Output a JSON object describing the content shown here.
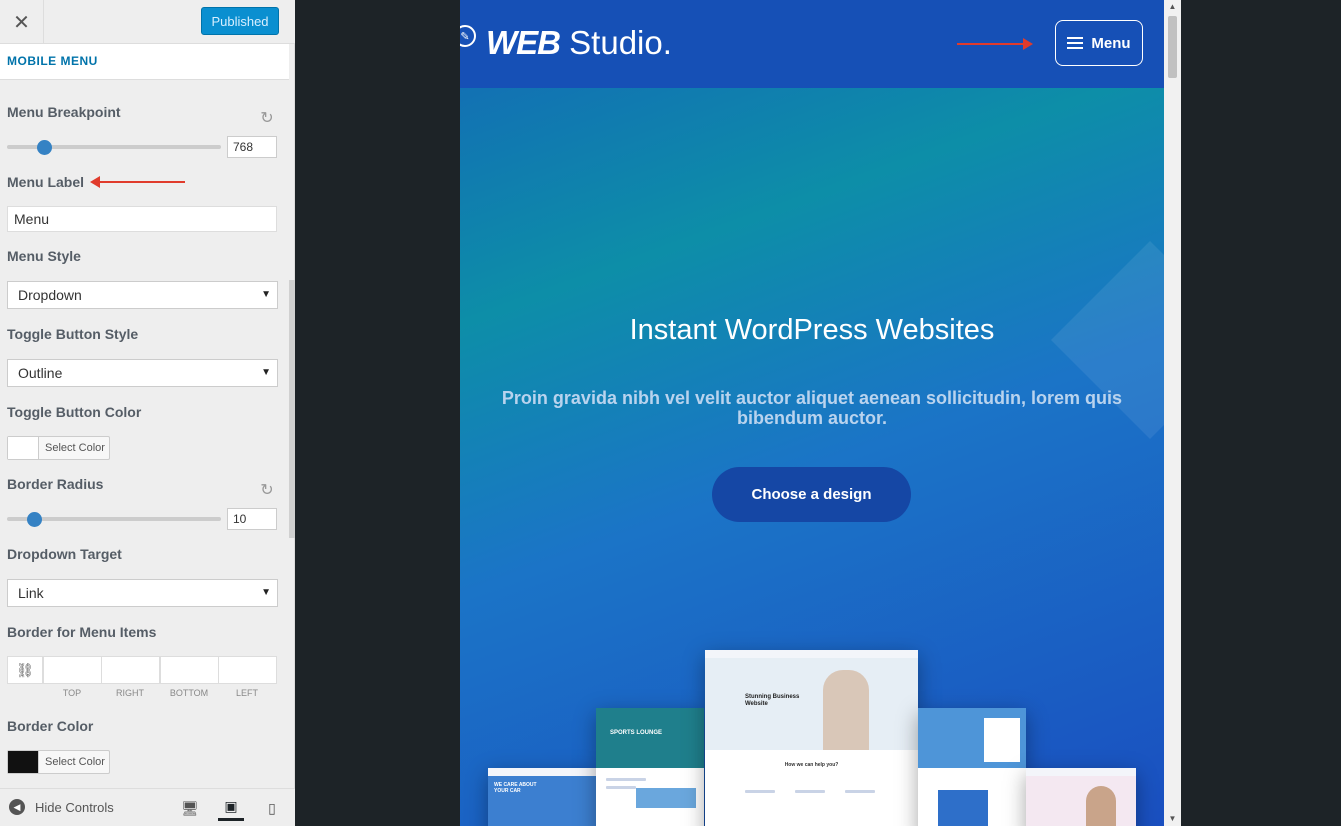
{
  "header": {
    "close_icon": "close-icon",
    "publish_label": "Published"
  },
  "section": {
    "title": "MOBILE MENU"
  },
  "controls": {
    "menu_breakpoint": {
      "label": "Menu Breakpoint",
      "value": "768",
      "fraction": 0.15
    },
    "menu_label": {
      "label": "Menu Label",
      "value": "Menu"
    },
    "menu_style": {
      "label": "Menu Style",
      "value": "Dropdown"
    },
    "toggle_button_style": {
      "label": "Toggle Button Style",
      "value": "Outline"
    },
    "toggle_button_color": {
      "label": "Toggle Button Color",
      "button": "Select Color",
      "color": "#ffffff"
    },
    "border_radius": {
      "label": "Border Radius",
      "value": "10",
      "fraction": 0.1
    },
    "dropdown_target": {
      "label": "Dropdown Target",
      "value": "Link"
    },
    "border_menu_items": {
      "label": "Border for Menu Items",
      "captions": [
        "TOP",
        "RIGHT",
        "BOTTOM",
        "LEFT"
      ]
    },
    "border_color": {
      "label": "Border Color",
      "button": "Select Color",
      "color": "#111111"
    }
  },
  "footer": {
    "hide_controls": "Hide Controls",
    "devices": [
      "desktop-icon",
      "tablet-icon",
      "mobile-icon"
    ],
    "active_device": "tablet-icon"
  },
  "preview": {
    "logo_bold": "WEB",
    "logo_light": " Studio.",
    "menu_button": "Menu",
    "hero_title": "Instant WordPress Websites",
    "hero_subtitle": "Proin gravida nibh vel velit auctor aliquet aenean sollicitudin, lorem quis bibendum auctor.",
    "cta": "Choose a design",
    "mockups": {
      "center_heading": "Stunning Business Website",
      "center_subheading": "How we can help you?",
      "left_heading": "SPORTS LOUNGE",
      "far_left_heading": "WE CARE ABOUT YOUR CAR"
    }
  },
  "colors": {
    "accent": "#0a8fd0",
    "annotation_arrow": "#e03b2c",
    "header_bg": "#1650b6"
  }
}
